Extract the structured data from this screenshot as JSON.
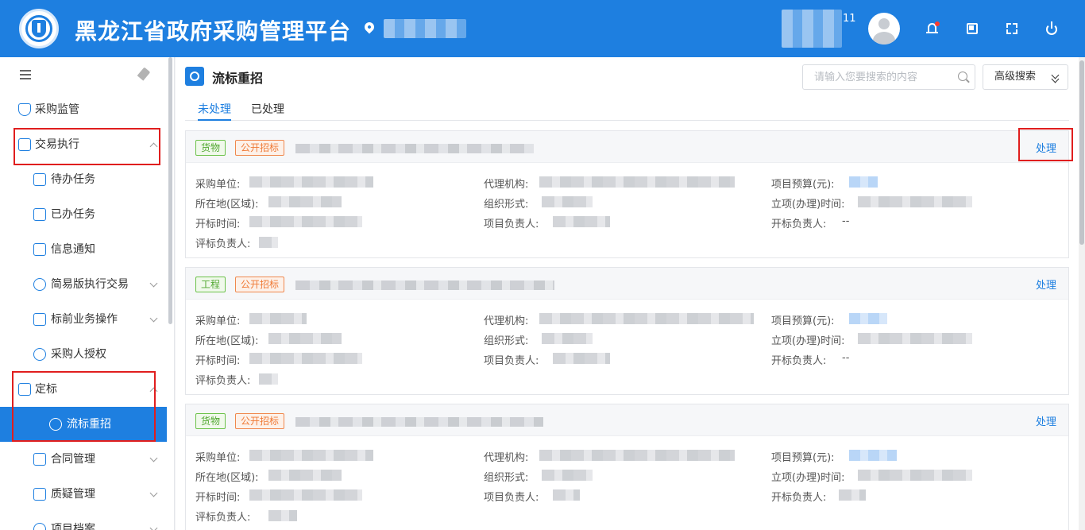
{
  "header": {
    "app_title": "黑龙江省政府采购管理平台",
    "user_badge": "11"
  },
  "sidebar": {
    "items": [
      {
        "label": "采购监管",
        "icon": "shield-check-icon"
      },
      {
        "label": "交易执行",
        "icon": "document-yen-icon",
        "expanded": true
      },
      {
        "label": "待办任务",
        "icon": "task-doc-icon"
      },
      {
        "label": "已办任务",
        "icon": "task-doc-icon"
      },
      {
        "label": "信息通知",
        "icon": "notice-doc-icon"
      },
      {
        "label": "简易版执行交易",
        "icon": "slash-circle-icon"
      },
      {
        "label": "标前业务操作",
        "icon": "cart-icon"
      },
      {
        "label": "采购人授权",
        "icon": "user-shield-icon"
      },
      {
        "label": "定标",
        "icon": "image-check-icon",
        "expanded": true
      },
      {
        "label": "流标重招",
        "icon": "play-circle-icon",
        "active": true
      },
      {
        "label": "合同管理",
        "icon": "list-doc-icon"
      },
      {
        "label": "质疑管理",
        "icon": "cart-icon"
      },
      {
        "label": "项目档案",
        "icon": "user-circle-icon"
      }
    ]
  },
  "main": {
    "page_title": "流标重招",
    "search_placeholder": "请输入您要搜索的内容",
    "advanced_search": "高级搜索",
    "tabs": [
      "未处理",
      "已处理"
    ],
    "action_label": "处理",
    "field_labels": {
      "purchaser": "采购单位:",
      "agency": "代理机构:",
      "budget": "项目预算(元):",
      "region": "所在地(区域):",
      "org_form": "组织形式:",
      "approval_time": "立项(办理)时间:",
      "opening_time": "开标时间:",
      "project_lead": "项目负责人:",
      "opening_lead": "开标负责人:",
      "eval_lead": "评标负责人:"
    },
    "records": [
      {
        "type_tag": "货物",
        "method_tag": "公开招标",
        "opening_lead_value": "--"
      },
      {
        "type_tag": "工程",
        "method_tag": "公开招标",
        "opening_lead_value": "--"
      },
      {
        "type_tag": "货物",
        "method_tag": "公开招标",
        "opening_lead_value": ""
      }
    ]
  },
  "colors": {
    "primary": "#1e7fe0",
    "highlight_box": "#e01e1e",
    "tag_goods": "#52a832",
    "tag_method": "#ef7a36"
  }
}
